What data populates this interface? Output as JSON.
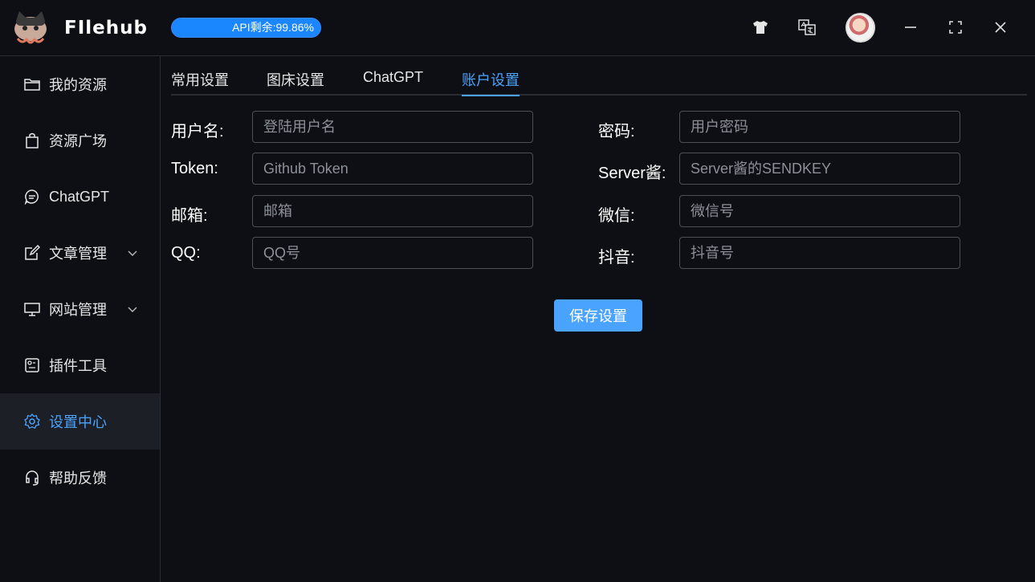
{
  "app": {
    "brand": "FIlehub",
    "api_status": "API剩余:99.86%",
    "api_remaining_percent": 99.86
  },
  "titlebar": {
    "icons": [
      "tshirt-icon",
      "translate-icon"
    ],
    "controls": [
      "minimize-icon",
      "maximize-icon",
      "close-icon"
    ]
  },
  "sidebar": {
    "items": [
      {
        "label": "我的资源",
        "icon": "folder-icon"
      },
      {
        "label": "资源广场",
        "icon": "shopping-bag-icon"
      },
      {
        "label": "ChatGPT",
        "icon": "chat-icon"
      },
      {
        "label": "文章管理",
        "icon": "edit-icon",
        "expandable": true
      },
      {
        "label": "网站管理",
        "icon": "monitor-icon",
        "expandable": true
      },
      {
        "label": "插件工具",
        "icon": "plugin-icon"
      },
      {
        "label": "设置中心",
        "icon": "gear-icon",
        "active": true
      },
      {
        "label": "帮助反馈",
        "icon": "headset-icon"
      }
    ]
  },
  "tabs": [
    {
      "label": "常用设置"
    },
    {
      "label": "图床设置"
    },
    {
      "label": "ChatGPT"
    },
    {
      "label": "账户设置",
      "active": true
    }
  ],
  "form": {
    "username": {
      "label": "用户名:",
      "placeholder": "登陆用户名",
      "value": ""
    },
    "password": {
      "label": "密码:",
      "placeholder": "用户密码",
      "value": ""
    },
    "token": {
      "label": "Token:",
      "placeholder": "Github Token",
      "value": ""
    },
    "server_jiang": {
      "label": "Server酱:",
      "placeholder": "Server酱的SENDKEY",
      "value": ""
    },
    "email": {
      "label": "邮箱:",
      "placeholder": "邮箱",
      "value": ""
    },
    "wechat": {
      "label": "微信:",
      "placeholder": "微信号",
      "value": ""
    },
    "qq": {
      "label": "QQ:",
      "placeholder": "QQ号",
      "value": ""
    },
    "douyin": {
      "label": "抖音:",
      "placeholder": "抖音号",
      "value": ""
    },
    "save_label": "保存设置"
  },
  "colors": {
    "accent": "#4aa3ff",
    "background": "#0d0f14",
    "active_bg": "#1c1f26",
    "border": "#4b4f57"
  }
}
